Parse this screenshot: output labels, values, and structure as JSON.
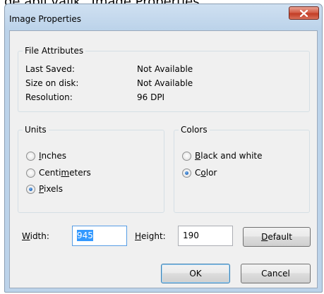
{
  "caption": "de abil valik „Image Properties\",",
  "dialog": {
    "title": "Image Properties",
    "close_icon": "close-x-icon"
  },
  "file_attributes": {
    "legend": "File Attributes",
    "rows": [
      {
        "label": "Last Saved:",
        "value": "Not Available"
      },
      {
        "label": "Size on disk:",
        "value": "Not Available"
      },
      {
        "label": "Resolution:",
        "value": "96 DPI"
      }
    ]
  },
  "units": {
    "legend": "Units",
    "options": [
      {
        "before": "",
        "key": "I",
        "after": "nches",
        "checked": false
      },
      {
        "before": "Centi",
        "key": "m",
        "after": "eters",
        "checked": false
      },
      {
        "before": "",
        "key": "P",
        "after": "ixels",
        "checked": true
      }
    ]
  },
  "colors": {
    "legend": "Colors",
    "options": [
      {
        "before": "",
        "key": "B",
        "after": "lack and white",
        "checked": false
      },
      {
        "before": "C",
        "key": "o",
        "after": "lor",
        "checked": true
      }
    ]
  },
  "size": {
    "width_key": "W",
    "width_rest": "idth:",
    "width_value": "945",
    "height_key": "H",
    "height_rest": "eight:",
    "height_value": "190",
    "default_key": "D",
    "default_rest": "efault"
  },
  "buttons": {
    "ok": "OK",
    "cancel": "Cancel"
  },
  "colors_palette": {
    "accent": "#3399ff",
    "close_button": "#c23d26",
    "title_bar": "#bcd3ea"
  }
}
